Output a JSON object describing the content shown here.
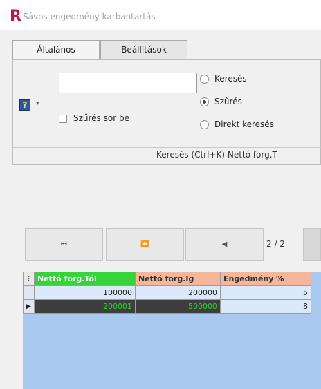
{
  "window": {
    "logo_letter": "R",
    "title": "Sávos engedmény karbantartás"
  },
  "tabs": [
    {
      "label": "Általános",
      "active": true
    },
    {
      "label": "Beállítások",
      "active": false
    }
  ],
  "ribbon": {
    "help_icon_glyph": "?",
    "help_dropdown_glyph": "▾",
    "search_value": "",
    "filter_checkbox_label": "Szűrés sor be",
    "filter_checked": false,
    "radio_options": [
      {
        "label": "Keresés",
        "selected": false
      },
      {
        "label": "Szűrés",
        "selected": true
      },
      {
        "label": "Direkt keresés",
        "selected": false
      }
    ],
    "footer_text": "Keresés (Ctrl+K) Nettó forg.T"
  },
  "navigator": {
    "first_glyph": "⏮",
    "prev_page_glyph": "⏪",
    "prev_glyph": "◀",
    "page_info": "2 / 2"
  },
  "grid": {
    "columns": [
      "Nettó forg.Tól",
      "Nettó forg.Ig",
      "Engedmény %"
    ],
    "rows": [
      {
        "from": "100000",
        "to": "200000",
        "discount": "5",
        "selected": false
      },
      {
        "from": "200001",
        "to": "500000",
        "discount": "8",
        "selected": true
      }
    ],
    "row_marker_glyph": "▶"
  },
  "colors": {
    "accent_green": "#36d43a",
    "header_salmon": "#f4b79b",
    "grid_bg": "#a9c9ef",
    "logo": "#b8164b"
  }
}
